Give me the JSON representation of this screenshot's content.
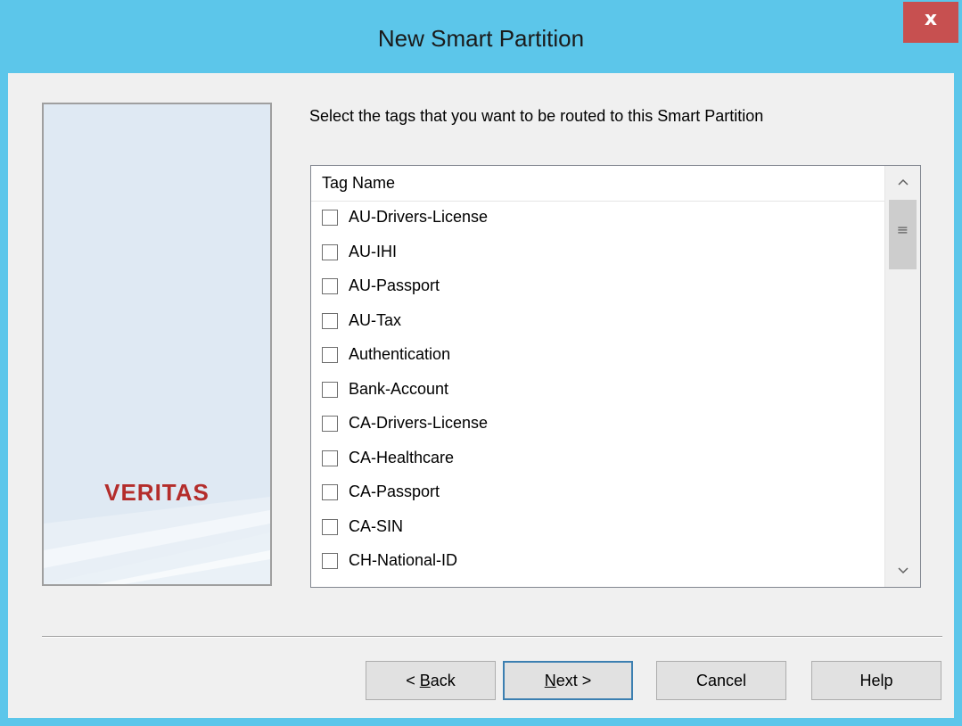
{
  "window": {
    "title": "New Smart Partition",
    "close_glyph": "x"
  },
  "banner": {
    "logo": "VERITAS"
  },
  "instruction": "Select the tags that you want to be routed to this Smart Partition",
  "tag_list": {
    "column_header": "Tag Name",
    "items": [
      {
        "label": "AU-Drivers-License",
        "checked": false
      },
      {
        "label": "AU-IHI",
        "checked": false
      },
      {
        "label": "AU-Passport",
        "checked": false
      },
      {
        "label": "AU-Tax",
        "checked": false
      },
      {
        "label": "Authentication",
        "checked": false
      },
      {
        "label": "Bank-Account",
        "checked": false
      },
      {
        "label": "CA-Drivers-License",
        "checked": false
      },
      {
        "label": "CA-Healthcare",
        "checked": false
      },
      {
        "label": "CA-Passport",
        "checked": false
      },
      {
        "label": "CA-SIN",
        "checked": false
      },
      {
        "label": "CH-National-ID",
        "checked": false
      }
    ],
    "scroll_up_glyph": "^",
    "scroll_down_glyph": "v",
    "thumb_grip_glyph": "≡"
  },
  "buttons": {
    "back": {
      "prefix": "< ",
      "mnemonic": "B",
      "rest": "ack"
    },
    "next": {
      "prefix": "",
      "mnemonic": "N",
      "rest": "ext >"
    },
    "cancel": "Cancel",
    "help": "Help"
  },
  "colors": {
    "title_bar": "#5cc6ea",
    "close_button": "#c75050",
    "logo": "#b42d2b",
    "default_button_border": "#3c7fb1"
  }
}
